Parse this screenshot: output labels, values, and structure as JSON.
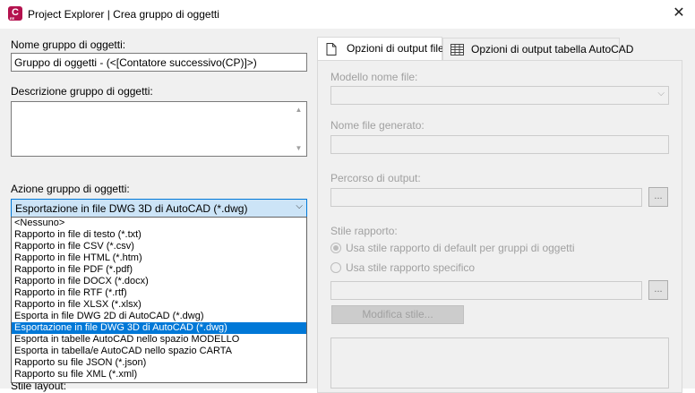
{
  "window": {
    "title": "Project Explorer | Crea gruppo di oggetti",
    "close_glyph": "✕",
    "app_icon_letter": "C",
    "app_icon_sub": "EE"
  },
  "left": {
    "name_label": "Nome gruppo di oggetti:",
    "name_value": "Gruppo di oggetti - (<[Contatore successivo(CP)]>)",
    "desc_label": "Descrizione gruppo di oggetti:",
    "desc_value": "",
    "action_label": "Azione gruppo di oggetti:",
    "action_selected": "Esportazione in file DWG 3D di AutoCAD (*.dwg)",
    "hidden_label_fragment": "Stile layout:",
    "dropdown_options": [
      "<Nessuno>",
      "Rapporto in file di testo (*.txt)",
      "Rapporto in file CSV (*.csv)",
      "Rapporto in file HTML (*.htm)",
      "Rapporto in file PDF (*.pdf)",
      "Rapporto in file DOCX (*.docx)",
      "Rapporto in file RTF (*.rtf)",
      "Rapporto in file XLSX (*.xlsx)",
      "Esporta in file DWG 2D di AutoCAD (*.dwg)",
      "Esportazione in file DWG 3D di AutoCAD (*.dwg)",
      "Esporta in tabelle AutoCAD nello spazio MODELLO",
      "Esporta in tabella/e AutoCAD nello spazio CARTA",
      "Rapporto su file JSON (*.json)",
      "Rapporto su file XML (*.xml)"
    ],
    "selected_index": 9
  },
  "tabs": [
    {
      "label": "Opzioni di output file",
      "icon": "document-icon",
      "active": true
    },
    {
      "label": "Opzioni di output tabella AutoCAD",
      "icon": "table-icon",
      "active": false
    }
  ],
  "output": {
    "template_label": "Modello nome file:",
    "template_value": "",
    "generated_label": "Nome file generato:",
    "generated_value": "",
    "path_label": "Percorso di output:",
    "path_value": "",
    "browse_glyph": "...",
    "style_label": "Stile rapporto:",
    "radio_default": "Usa stile rapporto di default per gruppi di oggetti",
    "radio_specific": "Usa stile rapporto specifico",
    "style_value": "",
    "edit_style_button": "Modifica stile..."
  }
}
